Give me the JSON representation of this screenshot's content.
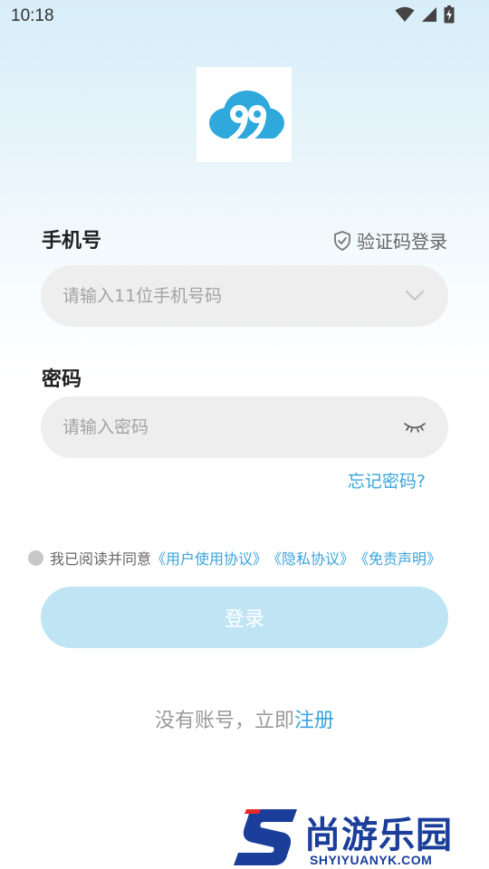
{
  "status_bar": {
    "time": "10:18",
    "icons": [
      "wifi-icon",
      "signal-icon",
      "battery-charging-icon"
    ]
  },
  "logo": {
    "icon": "cloud-99-logo",
    "color": "#2fa8dc"
  },
  "phone": {
    "label": "手机号",
    "placeholder": "请输入11位手机号码",
    "value": "",
    "dropdown_icon": "chevron-down-icon"
  },
  "code_login": {
    "label": "验证码登录",
    "icon": "shield-check-icon"
  },
  "password": {
    "label": "密码",
    "placeholder": "请输入密码",
    "value": "",
    "toggle_icon": "eye-closed-icon"
  },
  "forgot": {
    "label": "忘记密码?"
  },
  "agreement": {
    "checked": false,
    "prefix": "我已阅读并同意",
    "user_agreement": "《用户使用协议》",
    "privacy": "《隐私协议》",
    "disclaimer": "《免责声明》"
  },
  "login_button": {
    "label": "登录",
    "color": "#bfe5f5"
  },
  "register": {
    "prefix": "没有账号，立即",
    "link": "注册"
  },
  "watermark": {
    "text": "尚游乐园",
    "url": "SHYIYUANYK.COM",
    "color": "#1a3e9a"
  },
  "colors": {
    "accent": "#3aa4dc",
    "field_bg": "#eeeeee"
  }
}
